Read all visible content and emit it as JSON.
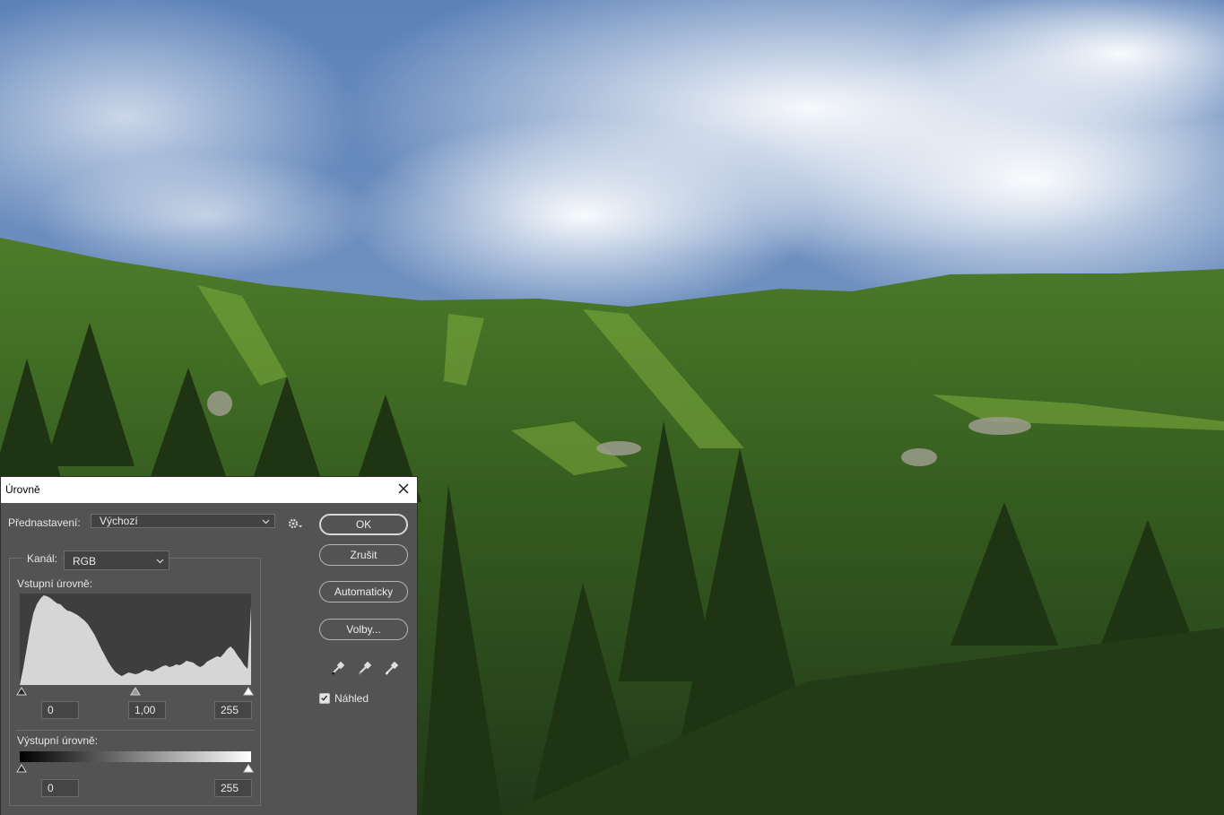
{
  "background": {
    "description_icon": "landscape-photo",
    "sky_colors": [
      "#4f77b0",
      "#dfe6ee"
    ],
    "grass_colors": [
      "#3f6a22",
      "#243f14"
    ]
  },
  "dialog": {
    "title": "Úrovně",
    "preset": {
      "label": "Přednastavení:",
      "value": "Výchozí"
    },
    "channel": {
      "label": "Kanál:",
      "value": "RGB"
    },
    "input_levels": {
      "label": "Vstupní úrovně:",
      "black": "0",
      "gamma": "1,00",
      "white": "255",
      "histogram": [
        0,
        18,
        40,
        62,
        80,
        90,
        96,
        100,
        99,
        97,
        94,
        91,
        90,
        86,
        83,
        82,
        80,
        78,
        75,
        72,
        68,
        62,
        56,
        48,
        40,
        33,
        26,
        20,
        15,
        12,
        10,
        12,
        14,
        13,
        12,
        13,
        15,
        17,
        16,
        15,
        17,
        19,
        21,
        22,
        20,
        21,
        23,
        22,
        24,
        27,
        26,
        25,
        22,
        20,
        22,
        26,
        28,
        30,
        32,
        31,
        35,
        40,
        43,
        39,
        33,
        28,
        22,
        18,
        88
      ]
    },
    "output_levels": {
      "label": "Výstupní úrovně:",
      "black": "0",
      "white": "255"
    },
    "buttons": {
      "ok": "OK",
      "cancel": "Zrušit",
      "auto": "Automaticky",
      "options": "Volby..."
    },
    "preview": {
      "label": "Náhled",
      "checked": true
    },
    "icons": [
      "close-icon",
      "gear-icon",
      "chevron-down-icon",
      "eyedropper-black-icon",
      "eyedropper-gray-icon",
      "eyedropper-white-icon",
      "checkmark-icon"
    ]
  }
}
